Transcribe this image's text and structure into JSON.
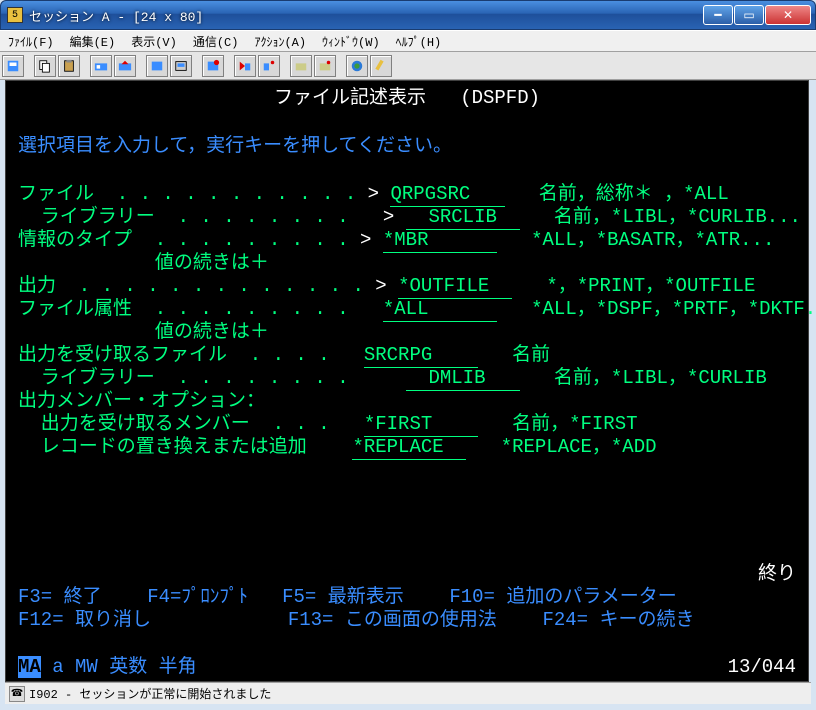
{
  "window": {
    "title": "セッション A - [24 x 80]"
  },
  "menu": {
    "file": "ﾌｧｲﾙ(F)",
    "edit": "編集(E)",
    "view": "表示(V)",
    "comm": "通信(C)",
    "action": "ｱｸｼｮﾝ(A)",
    "window": "ｳｨﾝﾄﾞｳ(W)",
    "help": "ﾍﾙﾌﾟ(H)"
  },
  "screen": {
    "title": "ファイル記述表示   (DSPFD)",
    "instruction": "選択項目を入力して，実行キーを押してください。",
    "rows": {
      "file": {
        "label": "ファイル  . . . . . . . . . . .",
        "val": "QRPGSRC   ",
        "hint": "名前，総称＊ ，*ALL"
      },
      "lib1": {
        "label": "  ライブラリー  . . . . . . . .  ",
        "val": "  SRCLIB  ",
        "hint": "名前，*LIBL，*CURLIB..."
      },
      "infotype": {
        "label": "情報のタイプ  . . . . . . . . .",
        "val": "*MBR      ",
        "hint": "*ALL，*BASATR，*ATR..."
      },
      "more1": "            値の続きは＋",
      "output": {
        "label": "出力  . . . . . . . . . . . . .",
        "val": "*OUTFILE  ",
        "hint": "*，*PRINT，*OUTFILE"
      },
      "fileattr": {
        "label": "ファイル属性  . . . . . . . . .",
        "val": "*ALL      ",
        "hint": "*ALL，*DSPF，*PRTF，*DKTF..."
      },
      "more2": "            値の続きは＋",
      "outfile": {
        "label": "出力を受け取るファイル  . . . .",
        "val": "SRCRPG    ",
        "hint": "名前"
      },
      "lib2": {
        "label": "  ライブラリー  . . . . . . . .  ",
        "val": "  DMLIB   ",
        "hint": "名前，*LIBL，*CURLIB"
      },
      "outmbropt": "出力メンバー・オプション：",
      "outmbr": {
        "label": "  出力を受け取るメンバー  . . .",
        "val": "*FIRST    ",
        "hint": "名前，*FIRST"
      },
      "replace": {
        "label": "  レコードの置き換えまたは追加 ",
        "val": "*REPLACE  ",
        "hint": "*REPLACE，*ADD"
      }
    },
    "bottom_indicator": "終り",
    "fkeys1": "F3= 終了    F4=ﾌﾟﾛﾝﾌﾟﾄ   F5= 最新表示    F10= 追加のパラメーター",
    "fkeys2": "F12= 取り消し            F13= この画面の使用法    F24= キーの続き",
    "status": {
      "ma": "MA",
      "a": "a",
      "mw": "MW",
      "mode": "英数 半角",
      "pos": "13/044"
    }
  },
  "statusbar": {
    "msg": "I902 - セッションが正常に開始されました"
  }
}
